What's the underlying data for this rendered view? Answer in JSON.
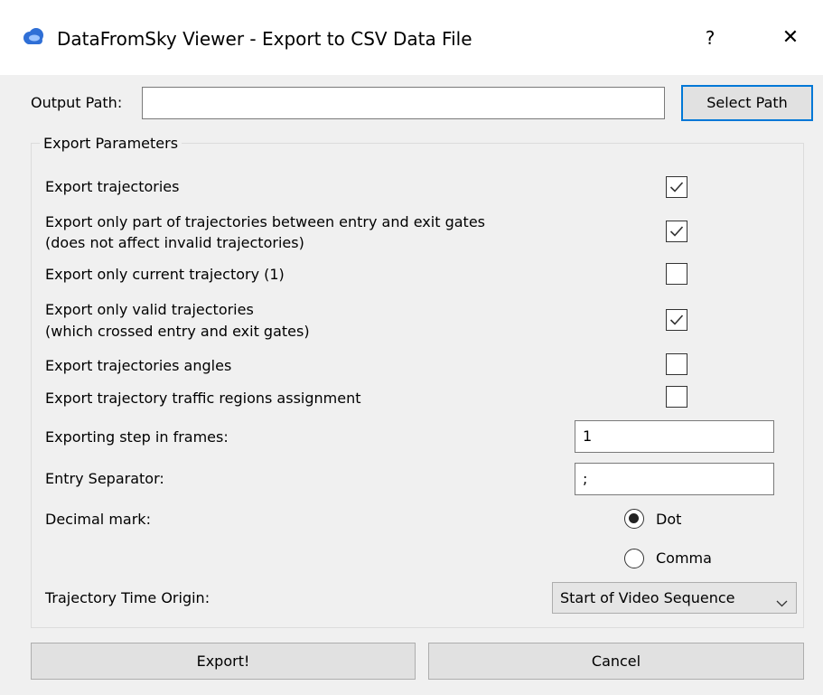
{
  "window": {
    "title": "DataFromSky Viewer - Export to CSV Data File",
    "help_glyph": "?",
    "close_glyph": "✕"
  },
  "output": {
    "label": "Output Path:",
    "value": "",
    "select_button": "Select Path"
  },
  "params": {
    "group_title": "Export Parameters",
    "checkboxes": [
      {
        "line1": "Export trajectories",
        "line2": "",
        "checked": true
      },
      {
        "line1": "Export only part of trajectories between entry and exit gates",
        "line2": "(does not affect invalid trajectories)",
        "checked": true
      },
      {
        "line1": "Export only current trajectory (1)",
        "line2": "",
        "checked": false
      },
      {
        "line1": "Export only valid trajectories",
        "line2": "(which crossed entry and exit gates)",
        "checked": true
      },
      {
        "line1": "Export trajectories angles",
        "line2": "",
        "checked": false
      },
      {
        "line1": "Export trajectory traffic regions assignment",
        "line2": "",
        "checked": false
      }
    ],
    "step": {
      "label": "Exporting step in frames:",
      "value": "1"
    },
    "separator": {
      "label": "Entry Separator:",
      "value": ";"
    },
    "decimal": {
      "label": "Decimal mark:",
      "options": [
        {
          "label": "Dot",
          "selected": true
        },
        {
          "label": "Comma",
          "selected": false
        }
      ]
    },
    "time_origin": {
      "label": "Trajectory Time Origin:",
      "value": "Start of Video Sequence"
    }
  },
  "buttons": {
    "export": "Export!",
    "cancel": "Cancel"
  },
  "colors": {
    "accent": "#0078d7",
    "dialog_bg": "#f0f0f0",
    "icon_blue": "#2f6fd6"
  },
  "icons": {
    "app": "cloud-app-icon",
    "checkmark": "checkmark-icon",
    "combo": "chevron-down-icon"
  }
}
